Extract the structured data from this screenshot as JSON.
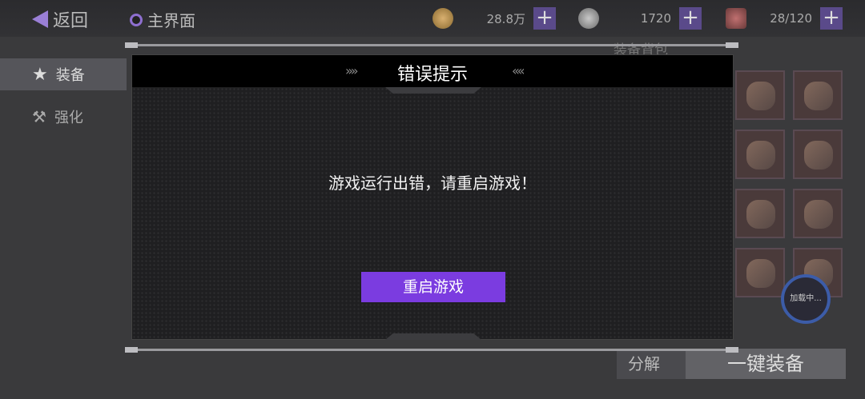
{
  "topbar": {
    "back_label": "返回",
    "home_label": "主界面",
    "coins": "28.8万",
    "energy": "1720",
    "capacity": "28/120",
    "plus_symbol": "+"
  },
  "sidebar": {
    "items": [
      {
        "label": "装备",
        "icon": "star-icon",
        "active": true
      },
      {
        "label": "强化",
        "icon": "anvil-icon",
        "active": false
      }
    ]
  },
  "bag": {
    "title": "装备背包"
  },
  "buttons": {
    "disassemble": "分解",
    "equip_all": "一键装备"
  },
  "loading": {
    "label": "加载中..."
  },
  "modal": {
    "title": "错误提示",
    "left_chevrons": "»»",
    "right_chevrons": "««",
    "message": "游戏运行出错，请重启游戏！",
    "restart_label": "重启游戏"
  },
  "colors": {
    "accent_purple": "#7b3ce0",
    "modal_bg": "#1f1f21",
    "header_bg": "#000000"
  }
}
